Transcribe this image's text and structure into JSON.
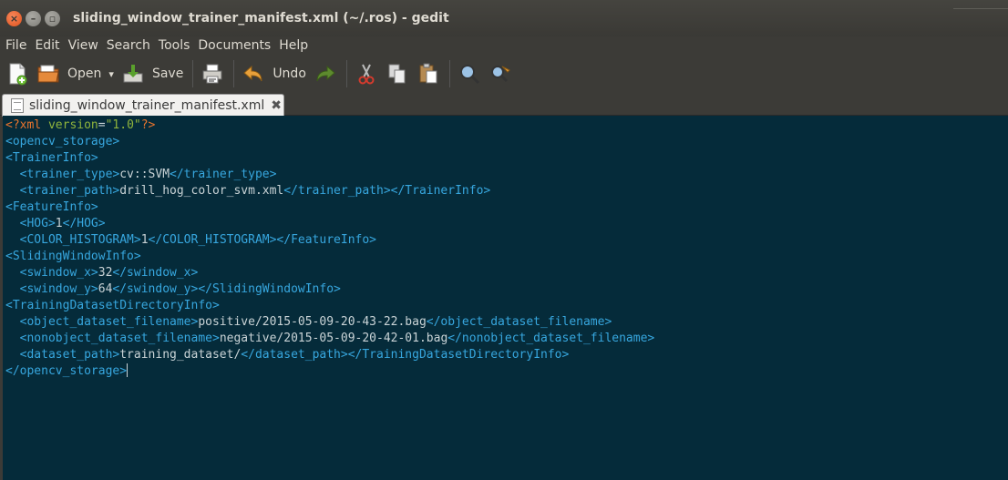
{
  "window": {
    "title": "sliding_window_trainer_manifest.xml (~/.ros) - gedit"
  },
  "menu": [
    "File",
    "Edit",
    "View",
    "Search",
    "Tools",
    "Documents",
    "Help"
  ],
  "toolbar": {
    "open_label": "Open",
    "save_label": "Save",
    "undo_label": "Undo",
    "dropdown_glyph": "▾"
  },
  "tab": {
    "label": "sliding_window_trainer_manifest.xml",
    "close_glyph": "✖"
  },
  "icons": [
    "new-document-icon",
    "open-folder-icon",
    "save-icon",
    "print-icon",
    "undo-icon",
    "redo-icon",
    "cut-icon",
    "copy-icon",
    "paste-icon",
    "find-icon",
    "find-replace-icon"
  ],
  "colors": {
    "editor_bg": "#052b3a",
    "tag": "#37a7df",
    "text": "#c9d3d6",
    "pi": "#e8742d",
    "attr": "#8fb43c"
  },
  "editor": {
    "lines": [
      [
        [
          "pi",
          "<?xml "
        ],
        [
          "attr",
          "version"
        ],
        [
          "txt",
          "="
        ],
        [
          "attr",
          "\"1.0\""
        ],
        [
          "pi",
          "?>"
        ]
      ],
      [
        [
          "tag",
          "<opencv_storage>"
        ]
      ],
      [
        [
          "tag",
          "<TrainerInfo>"
        ]
      ],
      [
        [
          "txt",
          "  "
        ],
        [
          "tag",
          "<trainer_type>"
        ],
        [
          "txt",
          "cv::SVM"
        ],
        [
          "tag",
          "</trainer_type>"
        ]
      ],
      [
        [
          "txt",
          "  "
        ],
        [
          "tag",
          "<trainer_path>"
        ],
        [
          "txt",
          "drill_hog_color_svm.xml"
        ],
        [
          "tag",
          "</trainer_path></TrainerInfo>"
        ]
      ],
      [
        [
          "tag",
          "<FeatureInfo>"
        ]
      ],
      [
        [
          "txt",
          "  "
        ],
        [
          "tag",
          "<HOG>"
        ],
        [
          "txt",
          "1"
        ],
        [
          "tag",
          "</HOG>"
        ]
      ],
      [
        [
          "txt",
          "  "
        ],
        [
          "tag",
          "<COLOR_HISTOGRAM>"
        ],
        [
          "txt",
          "1"
        ],
        [
          "tag",
          "</COLOR_HISTOGRAM></FeatureInfo>"
        ]
      ],
      [
        [
          "tag",
          "<SlidingWindowInfo>"
        ]
      ],
      [
        [
          "txt",
          "  "
        ],
        [
          "tag",
          "<swindow_x>"
        ],
        [
          "txt",
          "32"
        ],
        [
          "tag",
          "</swindow_x>"
        ]
      ],
      [
        [
          "txt",
          "  "
        ],
        [
          "tag",
          "<swindow_y>"
        ],
        [
          "txt",
          "64"
        ],
        [
          "tag",
          "</swindow_y></SlidingWindowInfo>"
        ]
      ],
      [
        [
          "tag",
          "<TrainingDatasetDirectoryInfo>"
        ]
      ],
      [
        [
          "txt",
          "  "
        ],
        [
          "tag",
          "<object_dataset_filename>"
        ],
        [
          "txt",
          "positive/2015-05-09-20-43-22.bag"
        ],
        [
          "tag",
          "</object_dataset_filename>"
        ]
      ],
      [
        [
          "txt",
          "  "
        ],
        [
          "tag",
          "<nonobject_dataset_filename>"
        ],
        [
          "txt",
          "negative/2015-05-09-20-42-01.bag"
        ],
        [
          "tag",
          "</nonobject_dataset_filename>"
        ]
      ],
      [
        [
          "txt",
          "  "
        ],
        [
          "tag",
          "<dataset_path>"
        ],
        [
          "txt",
          "training_dataset/"
        ],
        [
          "tag",
          "</dataset_path></TrainingDatasetDirectoryInfo>"
        ]
      ],
      [
        [
          "tag",
          "</opencv_storage>"
        ]
      ]
    ]
  }
}
